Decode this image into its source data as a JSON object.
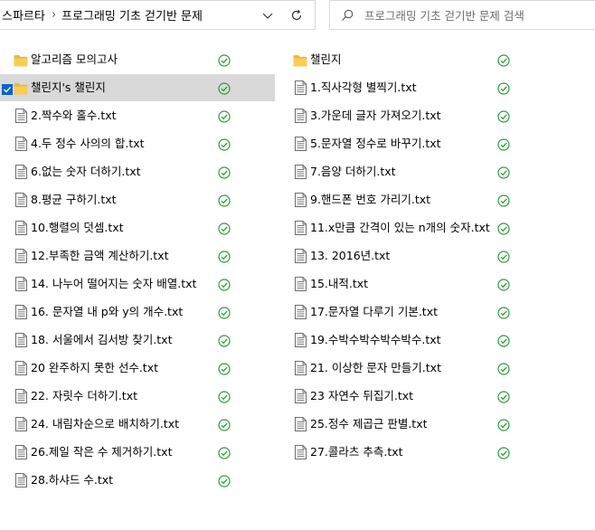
{
  "breadcrumb": {
    "root": "스파르타",
    "separator": "›",
    "current": "프로그래밍 기초 걷기반 문제"
  },
  "search": {
    "placeholder": "프로그래밍 기초 걷기반 문제 검색"
  },
  "colors": {
    "status_green": "#2b9b3a",
    "folder_yellow": "#e8b93a",
    "selection_bg": "#d9d9d9",
    "checkbox_blue": "#0a64c8"
  },
  "left_column": [
    {
      "name": "알고리즘 모의고사",
      "icon": "folder-icon",
      "status": "synced-check-icon"
    },
    {
      "name": "챌린지's 챌린지",
      "icon": "folder-icon",
      "status": "synced-check-icon",
      "selected": true
    },
    {
      "name": "2.짝수와 홀수.txt",
      "icon": "text-file-icon",
      "status": "synced-check-icon"
    },
    {
      "name": "4.두 정수 사의의 합.txt",
      "icon": "text-file-icon",
      "status": "synced-check-icon"
    },
    {
      "name": "6.없는 숫자 더하기.txt",
      "icon": "text-file-icon",
      "status": "synced-check-icon"
    },
    {
      "name": "8.평균 구하기.txt",
      "icon": "text-file-icon",
      "status": "synced-check-icon"
    },
    {
      "name": "10.행렬의 덧셈.txt",
      "icon": "text-file-icon",
      "status": "synced-check-icon"
    },
    {
      "name": "12.부족한 금액 계산하기.txt",
      "icon": "text-file-icon",
      "status": "synced-check-icon"
    },
    {
      "name": "14. 나누어 떨어지는 숫자 배열.txt",
      "icon": "text-file-icon",
      "status": "synced-check-icon"
    },
    {
      "name": "16. 문자열 내 p와 y의 개수.txt",
      "icon": "text-file-icon",
      "status": "synced-check-icon"
    },
    {
      "name": "18. 서울에서 김서방 찾기.txt",
      "icon": "text-file-icon",
      "status": "synced-check-icon"
    },
    {
      "name": "20 완주하지 못한 선수.txt",
      "icon": "text-file-icon",
      "status": "synced-check-icon"
    },
    {
      "name": "22. 자릿수 더하기.txt",
      "icon": "text-file-icon",
      "status": "synced-check-icon"
    },
    {
      "name": "24. 내림차순으로 배치하기.txt",
      "icon": "text-file-icon",
      "status": "synced-check-icon"
    },
    {
      "name": "26.제일 작은 수 제거하기.txt",
      "icon": "text-file-icon",
      "status": "synced-check-icon"
    },
    {
      "name": "28.하샤드 수.txt",
      "icon": "text-file-icon",
      "status": "synced-check-icon"
    }
  ],
  "right_column": [
    {
      "name": "챌린지",
      "icon": "folder-icon",
      "status": "synced-check-icon"
    },
    {
      "name": "1.직사각형 별찍기.txt",
      "icon": "text-file-icon",
      "status": "synced-check-icon"
    },
    {
      "name": "3.가운데 글자 가져오기.txt",
      "icon": "text-file-icon",
      "status": "synced-check-icon"
    },
    {
      "name": "5.문자열 정수로 바꾸기.txt",
      "icon": "text-file-icon",
      "status": "synced-check-icon"
    },
    {
      "name": "7.음양 더하기.txt",
      "icon": "text-file-icon",
      "status": "synced-check-icon"
    },
    {
      "name": "9.핸드폰 번호 가리기.txt",
      "icon": "text-file-icon",
      "status": "synced-check-icon"
    },
    {
      "name": "11.x만큼 간격이 있는 n개의 숫자.txt",
      "icon": "text-file-icon",
      "status": "synced-check-icon"
    },
    {
      "name": "13. 2016년.txt",
      "icon": "text-file-icon",
      "status": "synced-check-icon"
    },
    {
      "name": "15.내적.txt",
      "icon": "text-file-icon",
      "status": "synced-check-icon"
    },
    {
      "name": "17.문자열 다루기 기본.txt",
      "icon": "text-file-icon",
      "status": "synced-check-icon"
    },
    {
      "name": "19.수박수박수박수박수.txt",
      "icon": "text-file-icon",
      "status": "synced-check-icon"
    },
    {
      "name": "21. 이상한 문자 만들기.txt",
      "icon": "text-file-icon",
      "status": "synced-check-icon"
    },
    {
      "name": "23 자연수 뒤집기.txt",
      "icon": "text-file-icon",
      "status": "synced-check-icon"
    },
    {
      "name": "25.정수 제곱근 판별.txt",
      "icon": "text-file-icon",
      "status": "synced-check-icon"
    },
    {
      "name": "27.콜라츠 추측.txt",
      "icon": "text-file-icon",
      "status": "synced-check-icon"
    }
  ]
}
